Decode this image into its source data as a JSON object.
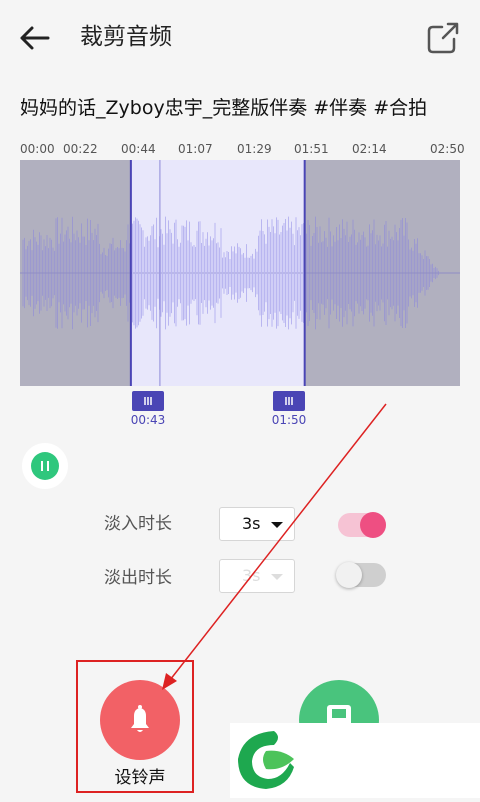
{
  "header": {
    "title": "裁剪音频",
    "back_icon": "arrow-left-icon",
    "share_icon": "external-link-icon"
  },
  "track": {
    "name": "妈妈的话_Zyboy忠宇_完整版伴奏 #伴奏 #合拍"
  },
  "timeline": {
    "ticks": [
      "00:00",
      "00:22",
      "00:44",
      "01:07",
      "01:29",
      "01:51",
      "02:14",
      "02:50"
    ]
  },
  "selection": {
    "start_label": "00:43",
    "end_label": "01:50",
    "start_fraction": 0.252,
    "end_fraction": 0.647,
    "marker_fraction": 0.318
  },
  "fade_in": {
    "label": "淡入时长",
    "value": "3s",
    "enabled": true
  },
  "fade_out": {
    "label": "淡出时长",
    "value": "3s",
    "enabled": false
  },
  "actions": {
    "ringtone_label": "设铃声",
    "ringtone_icon": "bell-icon",
    "save_icon": "save-icon"
  },
  "colors": {
    "selection": "#5a55c8",
    "waveform": "#9c99cf",
    "ringtone": "#f26166",
    "save": "#49c47d",
    "toggle_on": "#ee4f82",
    "annotation": "#d22222"
  }
}
